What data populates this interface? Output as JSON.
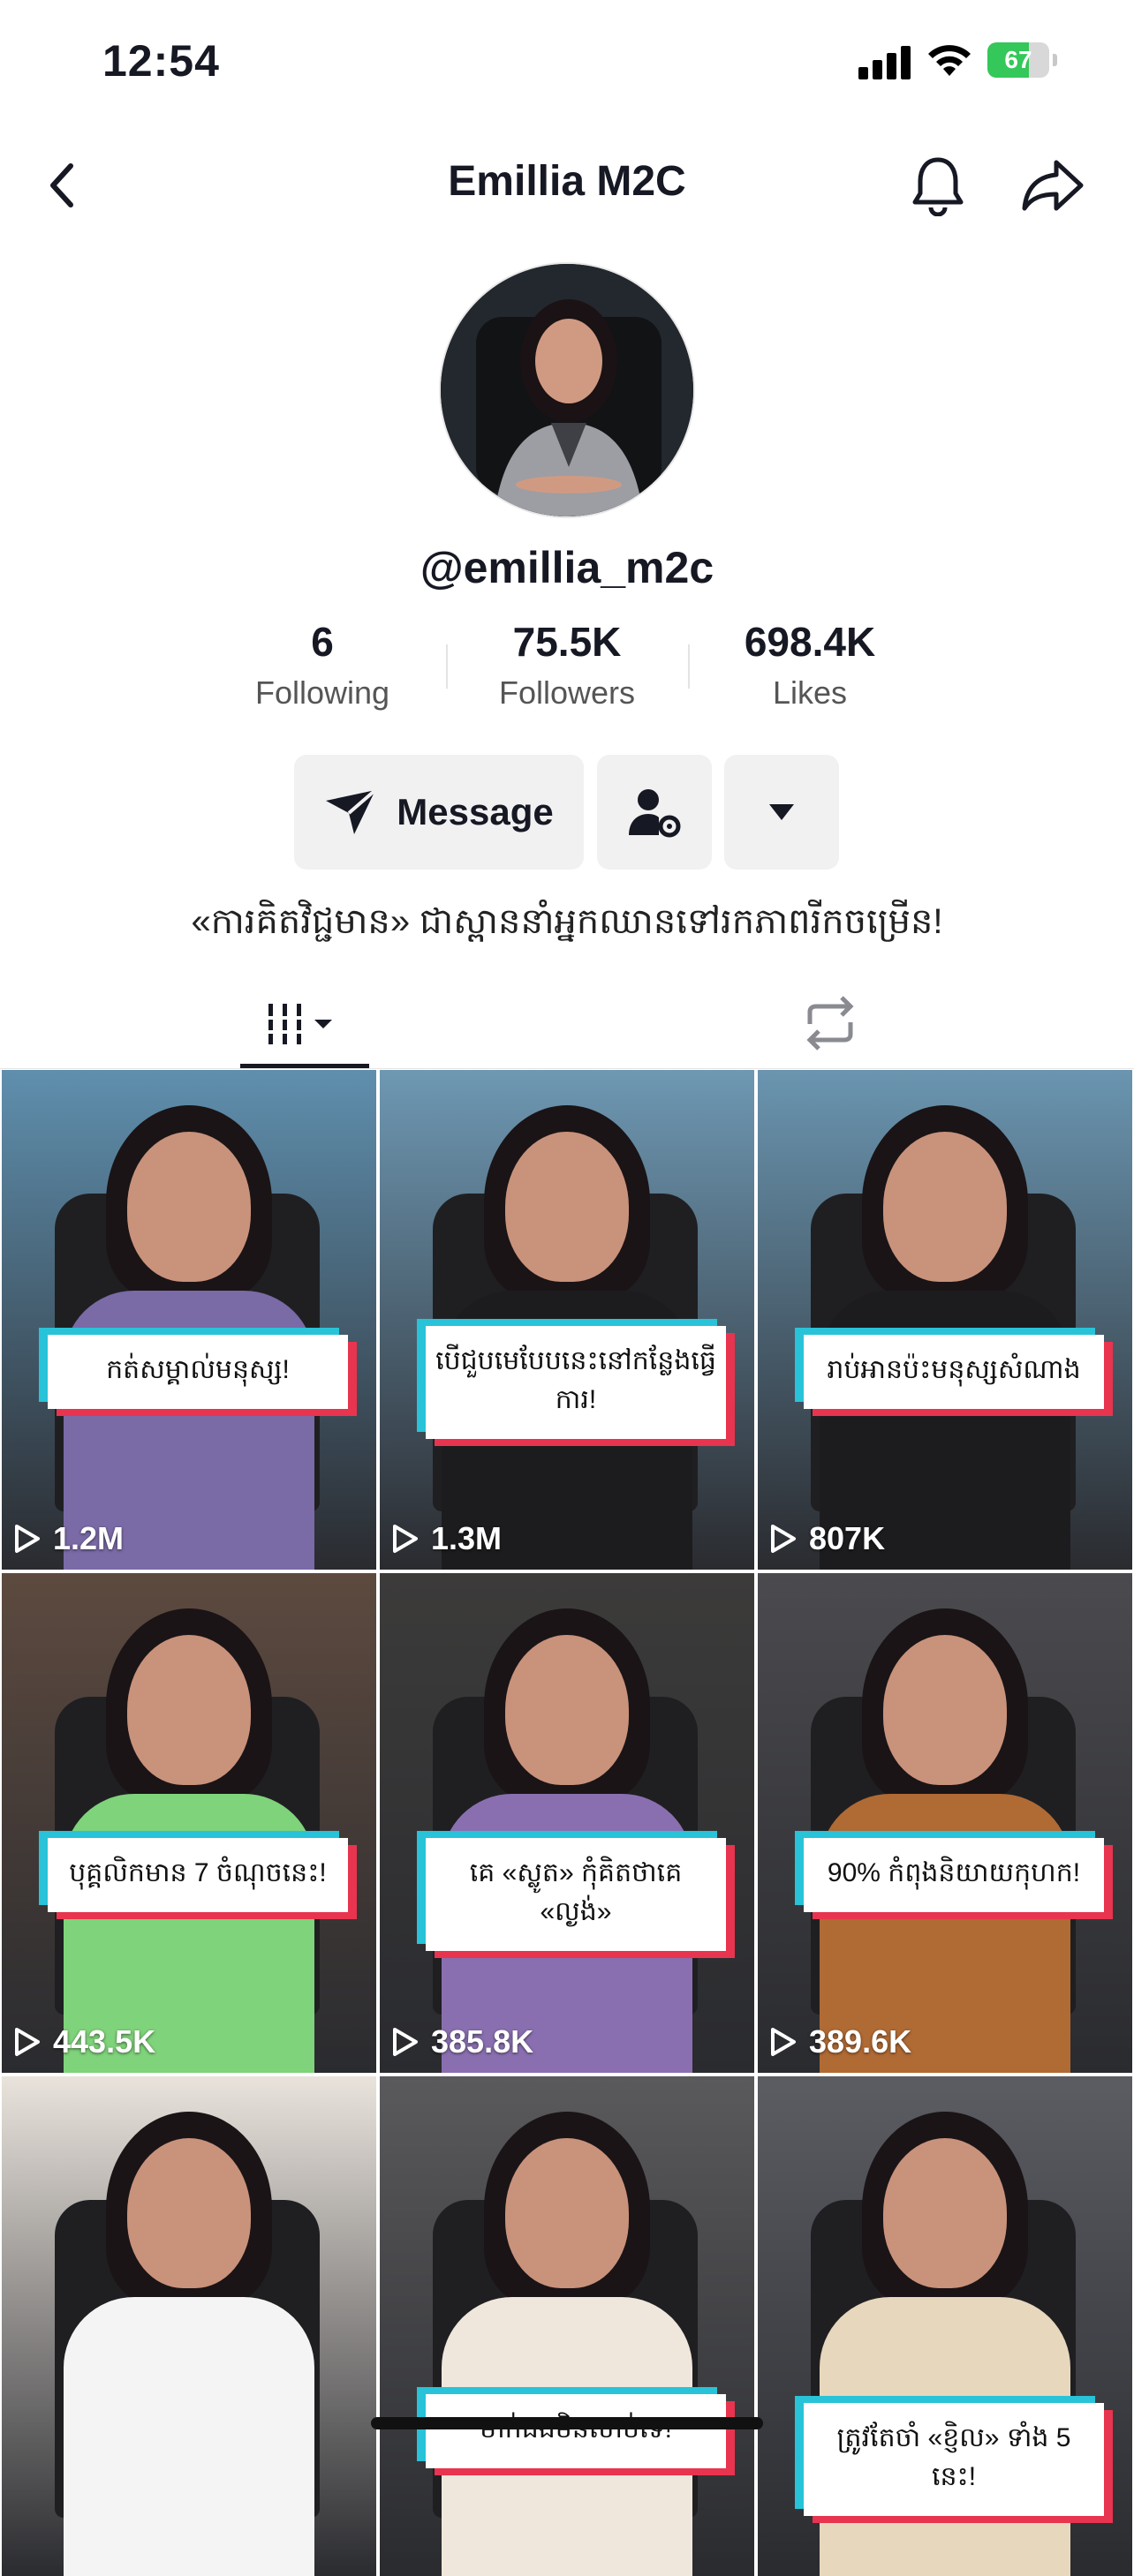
{
  "status_bar": {
    "time": "12:54",
    "battery": "67",
    "battery_level": 0.67
  },
  "header": {
    "title": "Emillia M2C"
  },
  "profile": {
    "username": "@emillia_m2c",
    "stats": [
      {
        "value": "6",
        "label": "Following"
      },
      {
        "value": "75.5K",
        "label": "Followers"
      },
      {
        "value": "698.4K",
        "label": "Likes"
      }
    ],
    "message_label": "Message",
    "bio": "«ការគិតវិជ្ជមាន» ជាស្ពាននាំអ្នកឈានទៅរកភាពរីកចម្រើន!"
  },
  "videos": [
    {
      "caption": "កត់សម្គាល់មនុស្ស!",
      "views": "1.2M",
      "bg": "#5f8fae",
      "outfit": "#7a6aa6"
    },
    {
      "caption": "បើជួបមេបែបនេះនៅកន្លែងធ្វើការ!",
      "views": "1.3M",
      "bg": "#6e98b3",
      "outfit": "#1c1c1f"
    },
    {
      "caption": "រាប់អានប៉ះមនុស្សសំណាង",
      "views": "807K",
      "bg": "#6a95b0",
      "outfit": "#1c1c1f"
    },
    {
      "caption": "បុគ្គលិកមាន 7 ចំណុចនេះ!",
      "views": "443.5K",
      "bg": "#5d4a3f",
      "outfit": "#7fd37a"
    },
    {
      "caption": "គេ «ស្លូត» កុំគិតថាគេ «ល្ងង់»",
      "views": "385.8K",
      "bg": "#3c3b3a",
      "outfit": "#8a6fb0"
    },
    {
      "caption": "90% កំពុងនិយាយកុហក!",
      "views": "389.6K",
      "bg": "#4b4b4f",
      "outfit": "#b06a34"
    },
    {
      "caption": "",
      "views": "",
      "bg": "#e9e3dc",
      "outfit": "#f4f4f4"
    },
    {
      "caption": "មាក់ឯងមិនសាប់ទេ!",
      "views": "",
      "bg": "#5a5a5c",
      "outfit": "#efe7dc"
    },
    {
      "caption": "ត្រូវតែចាំ «ខ្ញិល» ទាំង 5 នេះ!",
      "views": "",
      "bg": "#5b5d63",
      "outfit": "#e7d7bd"
    }
  ]
}
